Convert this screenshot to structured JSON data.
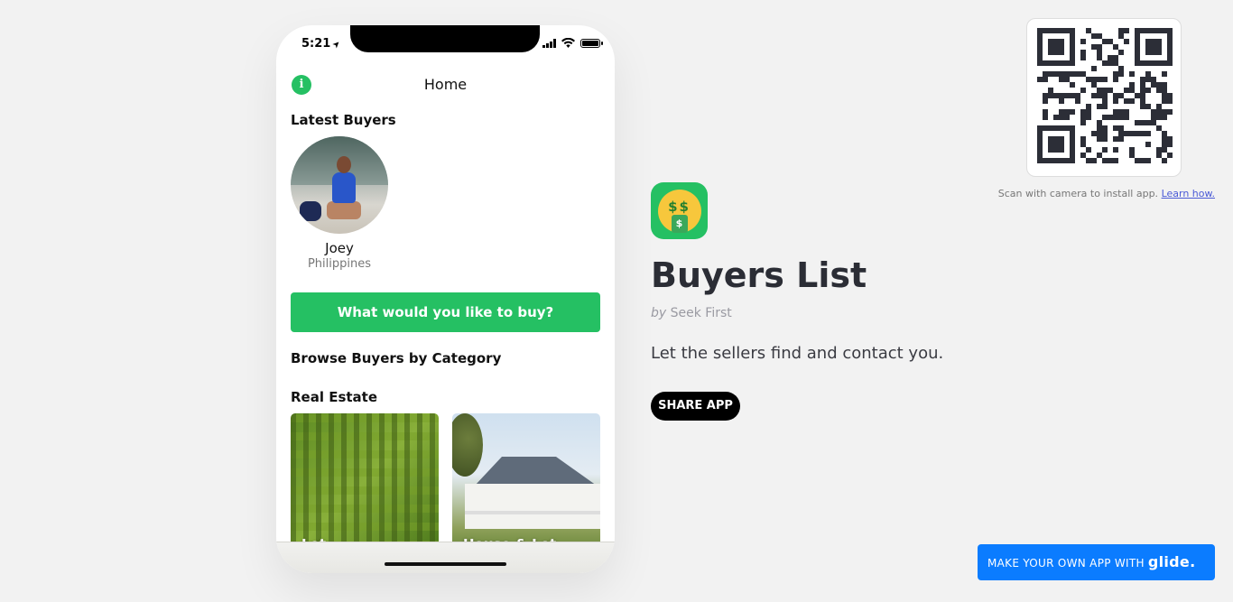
{
  "phone": {
    "status_time": "5:21",
    "screen_title": "Home",
    "latest_buyers_heading": "Latest Buyers",
    "buyer": {
      "name": "Joey",
      "country": "Philippines"
    },
    "buy_button_label": "What would you like to buy?",
    "browse_heading": "Browse Buyers by Category",
    "category_heading": "Real Estate",
    "tiles": [
      {
        "label": "Lot"
      },
      {
        "label": "House & Lot"
      }
    ]
  },
  "app": {
    "title": "Buyers List",
    "author_prefix": "by",
    "author": "Seek First",
    "description": "Let the sellers find and contact you.",
    "share_label": "SHARE APP",
    "icon": "money-mouth-face-icon"
  },
  "qr": {
    "caption": "Scan with camera to install app.",
    "learn_link": "Learn how."
  },
  "footer": {
    "glide_label": "MAKE YOUR OWN APP WITH",
    "glide_logo": "glide."
  },
  "colors": {
    "accent": "#25c063",
    "glide_blue": "#0b7cff",
    "background": "#f2f2f2"
  }
}
